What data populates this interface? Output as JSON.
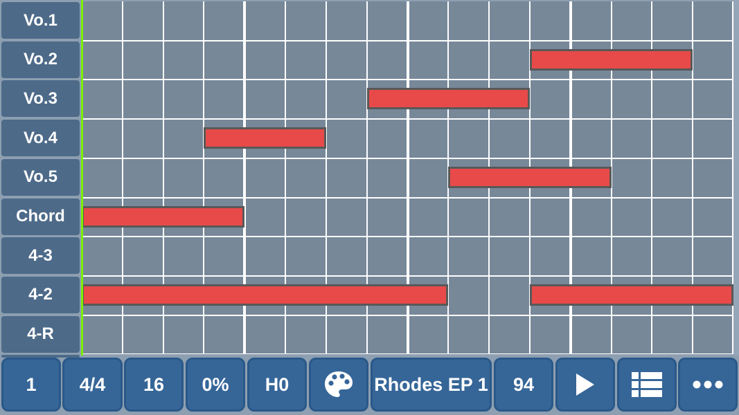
{
  "tracks": [
    {
      "label": "Vo.1"
    },
    {
      "label": "Vo.2"
    },
    {
      "label": "Vo.3"
    },
    {
      "label": "Vo.4"
    },
    {
      "label": "Vo.5"
    },
    {
      "label": "Chord"
    },
    {
      "label": "4-3"
    },
    {
      "label": "4-2"
    },
    {
      "label": "4-R"
    }
  ],
  "grid": {
    "columns": 16,
    "beats_per_bar": 4,
    "visible_rows": 9
  },
  "notes": [
    {
      "track": "Vo.2",
      "row": 1,
      "start": 11,
      "length": 4
    },
    {
      "track": "Vo.3",
      "row": 2,
      "start": 7,
      "length": 4
    },
    {
      "track": "Vo.4",
      "row": 3,
      "start": 3,
      "length": 3
    },
    {
      "track": "Vo.5",
      "row": 4,
      "start": 9,
      "length": 4
    },
    {
      "track": "Chord",
      "row": 5,
      "start": 0,
      "length": 4
    },
    {
      "track": "4-2",
      "row": 7,
      "start": 0,
      "length": 9
    },
    {
      "track": "4-2",
      "row": 7,
      "start": 11,
      "length": 5
    }
  ],
  "toolbar": {
    "bar_number": "1",
    "time_signature": "4/4",
    "steps": "16",
    "swing": "0%",
    "humanize": "H0",
    "palette_icon": "palette-icon",
    "instrument": "Rhodes EP 1",
    "tempo": "94",
    "play_icon": "play-icon",
    "list_icon": "list-icon",
    "more_icon": "more-icon"
  },
  "colors": {
    "note_fill": "#e84a4a",
    "note_border": "#585858",
    "playhead": "#7cf000",
    "grid_bg": "#778899",
    "button_bg": "#366698",
    "label_bg": "#4d6a89"
  }
}
